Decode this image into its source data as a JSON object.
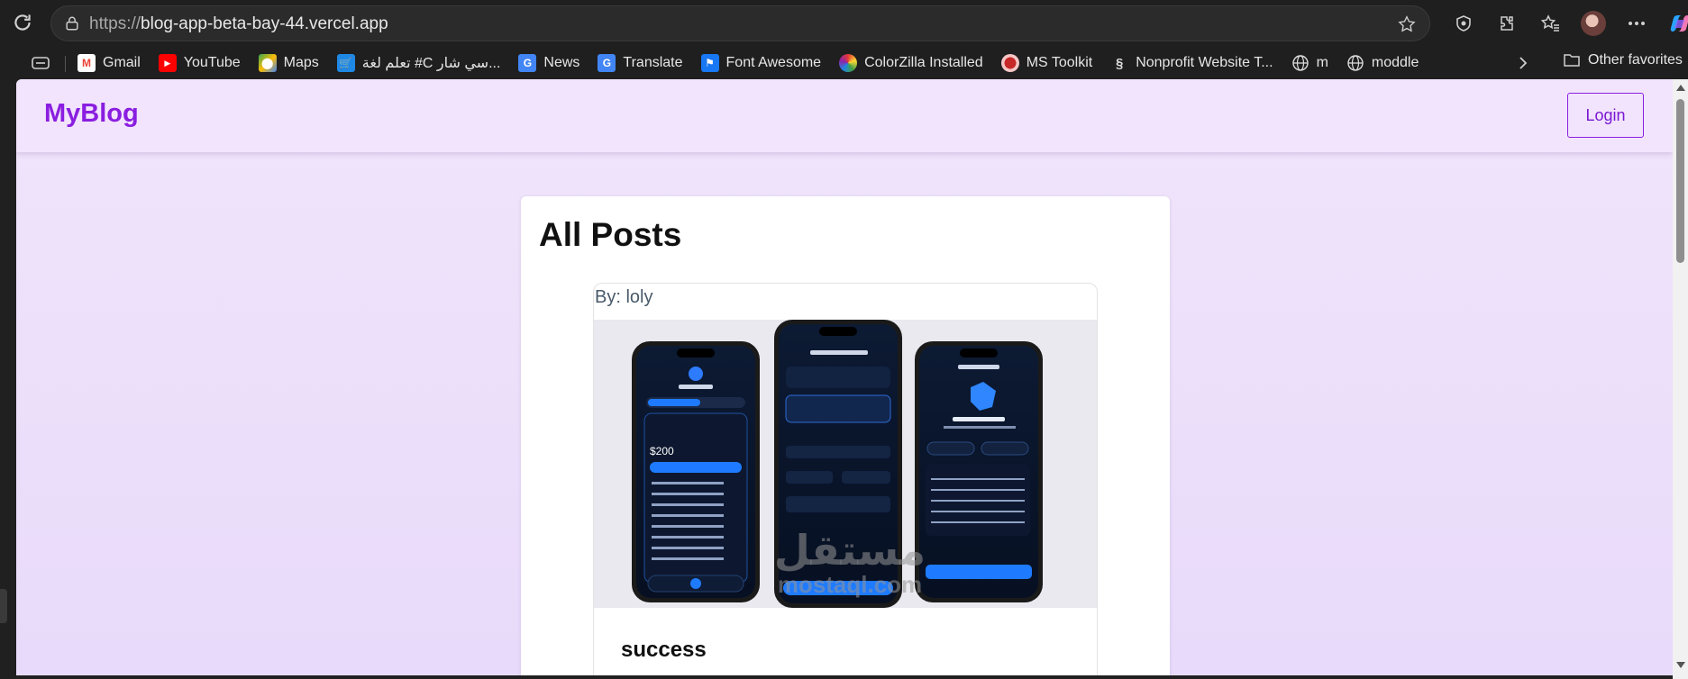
{
  "browser": {
    "url_scheme": "https://",
    "url_host": "blog-app-beta-bay-44.vercel.app",
    "bookmarks": [
      {
        "label": "Gmail",
        "icon": "gmail-icon",
        "color": "#ea4335"
      },
      {
        "label": "YouTube",
        "icon": "youtube-icon",
        "color": "#ff0000"
      },
      {
        "label": "Maps",
        "icon": "maps-icon",
        "color": "#34a853"
      },
      {
        "label": "تعلم لغة #C سي شار...",
        "icon": "shop-icon",
        "color": "#1e88e5"
      },
      {
        "label": "News",
        "icon": "google-news-icon",
        "color": "#4285f4"
      },
      {
        "label": "Translate",
        "icon": "translate-icon",
        "color": "#4285f4"
      },
      {
        "label": "Font Awesome",
        "icon": "flag-icon",
        "color": "#1877f2"
      },
      {
        "label": "ColorZilla Installed",
        "icon": "colorzilla-icon",
        "color": "#e53935"
      },
      {
        "label": "MS Toolkit",
        "icon": "mstoolkit-icon",
        "color": "#c62828"
      },
      {
        "label": "Nonprofit Website T...",
        "icon": "squarespace-icon",
        "color": "#dddddd"
      },
      {
        "label": "m",
        "icon": "globe-icon",
        "color": "#dddddd"
      },
      {
        "label": "moddle",
        "icon": "globe-icon",
        "color": "#dddddd"
      }
    ],
    "other_favorites": "Other favorites"
  },
  "navbar": {
    "brand": "MyBlog",
    "login_label": "Login",
    "brand_color": "#8a1ee0"
  },
  "main": {
    "title": "All Posts",
    "posts": [
      {
        "author": "By: loly",
        "title": "success"
      }
    ]
  },
  "watermark": {
    "arabic": "مستقل",
    "latin": "mostaql.com"
  }
}
